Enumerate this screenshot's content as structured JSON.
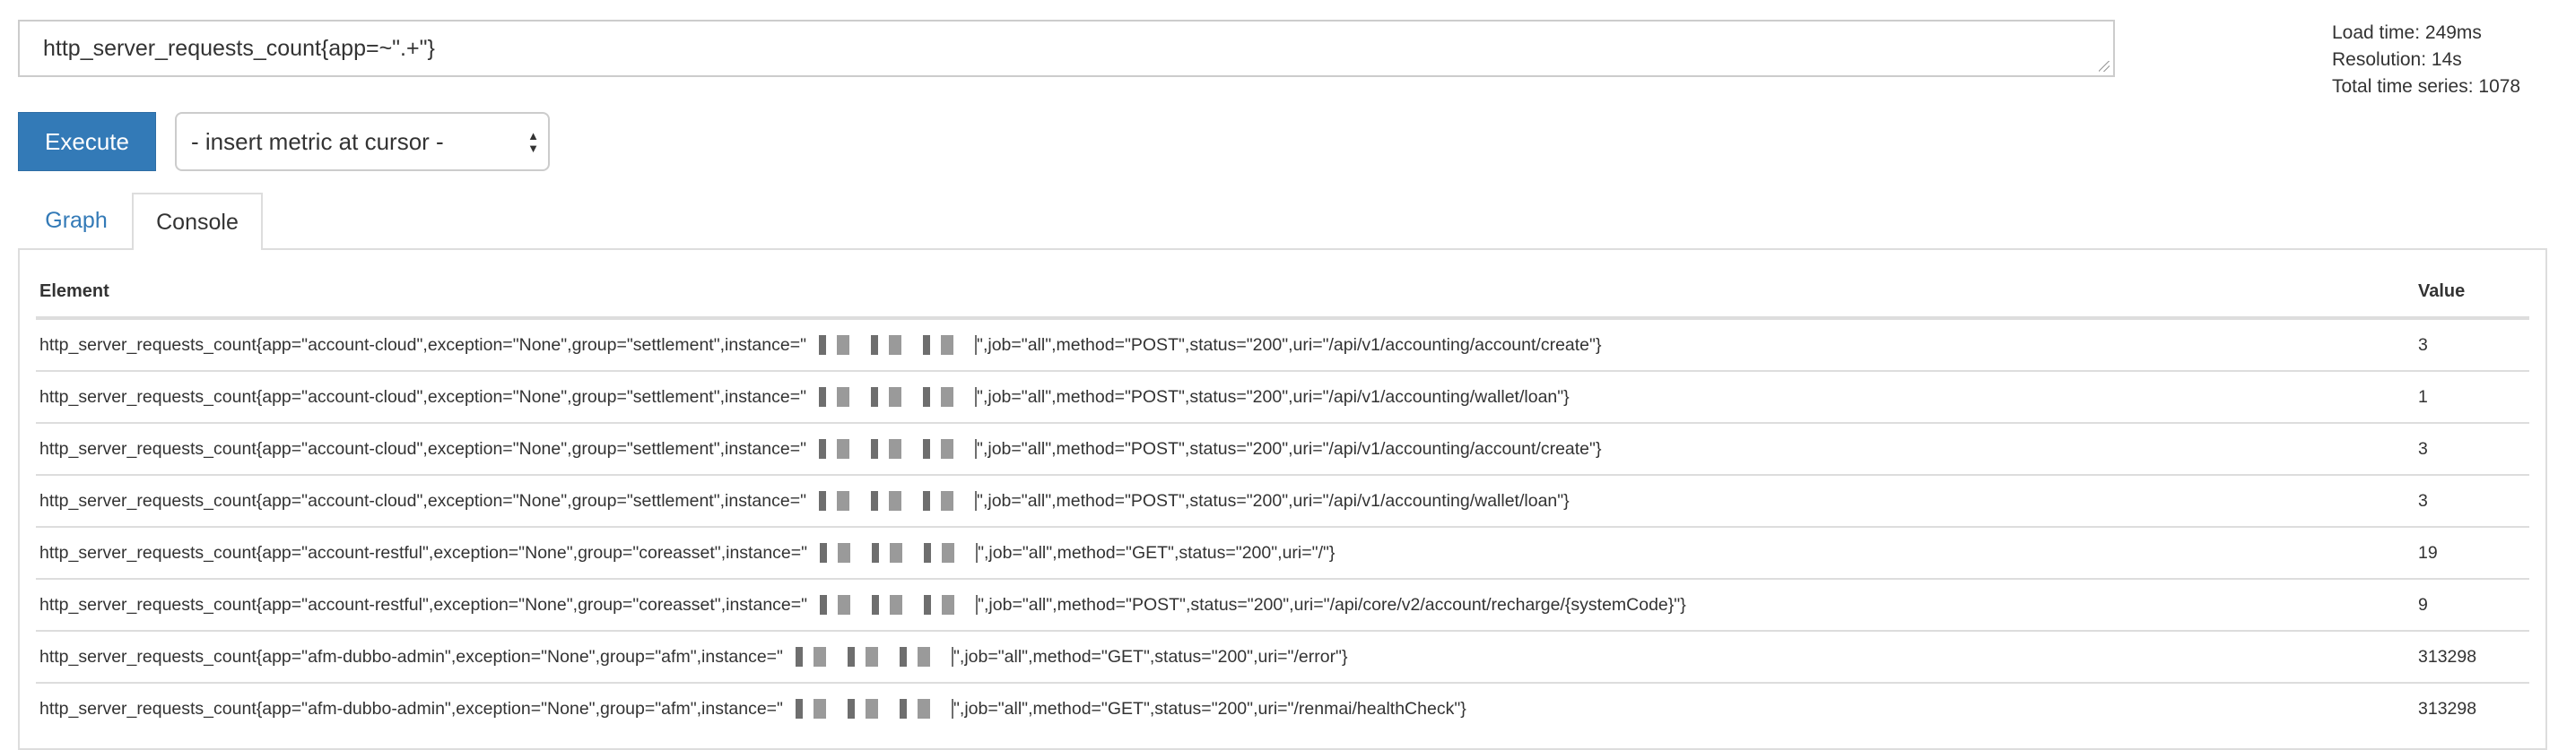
{
  "query": {
    "expression": "http_server_requests_count{app=~\".+\"}"
  },
  "stats": {
    "load_time": "Load time: 249ms",
    "resolution": "Resolution: 14s",
    "total_series": "Total time series: 1078"
  },
  "toolbar": {
    "execute_label": "Execute",
    "metric_select": "- insert metric at cursor -"
  },
  "tabs": [
    {
      "label": "Graph",
      "active": false
    },
    {
      "label": "Console",
      "active": true
    }
  ],
  "table": {
    "headers": {
      "element": "Element",
      "value": "Value"
    },
    "rows": [
      {
        "prefix": "http_server_requests_count{app=\"account-cloud\",exception=\"None\",group=\"settlement\",instance=\"",
        "suffix": "\",job=\"all\",method=\"POST\",status=\"200\",uri=\"/api/v1/accounting/account/create\"}",
        "value": "3"
      },
      {
        "prefix": "http_server_requests_count{app=\"account-cloud\",exception=\"None\",group=\"settlement\",instance=\"",
        "suffix": "\",job=\"all\",method=\"POST\",status=\"200\",uri=\"/api/v1/accounting/wallet/loan\"}",
        "value": "1"
      },
      {
        "prefix": "http_server_requests_count{app=\"account-cloud\",exception=\"None\",group=\"settlement\",instance=\"",
        "suffix": "\",job=\"all\",method=\"POST\",status=\"200\",uri=\"/api/v1/accounting/account/create\"}",
        "value": "3"
      },
      {
        "prefix": "http_server_requests_count{app=\"account-cloud\",exception=\"None\",group=\"settlement\",instance=\"",
        "suffix": "\",job=\"all\",method=\"POST\",status=\"200\",uri=\"/api/v1/accounting/wallet/loan\"}",
        "value": "3"
      },
      {
        "prefix": "http_server_requests_count{app=\"account-restful\",exception=\"None\",group=\"coreasset\",instance=\"",
        "suffix": "\",job=\"all\",method=\"GET\",status=\"200\",uri=\"/\"}",
        "value": "19"
      },
      {
        "prefix": "http_server_requests_count{app=\"account-restful\",exception=\"None\",group=\"coreasset\",instance=\"",
        "suffix": "\",job=\"all\",method=\"POST\",status=\"200\",uri=\"/api/core/v2/account/recharge/{systemCode}\"}",
        "value": "9"
      },
      {
        "prefix": "http_server_requests_count{app=\"afm-dubbo-admin\",exception=\"None\",group=\"afm\",instance=\"",
        "suffix": "\",job=\"all\",method=\"GET\",status=\"200\",uri=\"/error\"}",
        "value": "313298"
      },
      {
        "prefix": "http_server_requests_count{app=\"afm-dubbo-admin\",exception=\"None\",group=\"afm\",instance=\"",
        "suffix": "\",job=\"all\",method=\"GET\",status=\"200\",uri=\"/renmai/healthCheck\"}",
        "value": "313298"
      }
    ]
  },
  "colors": {
    "primary": "#337ab7",
    "border": "#dddddd"
  }
}
